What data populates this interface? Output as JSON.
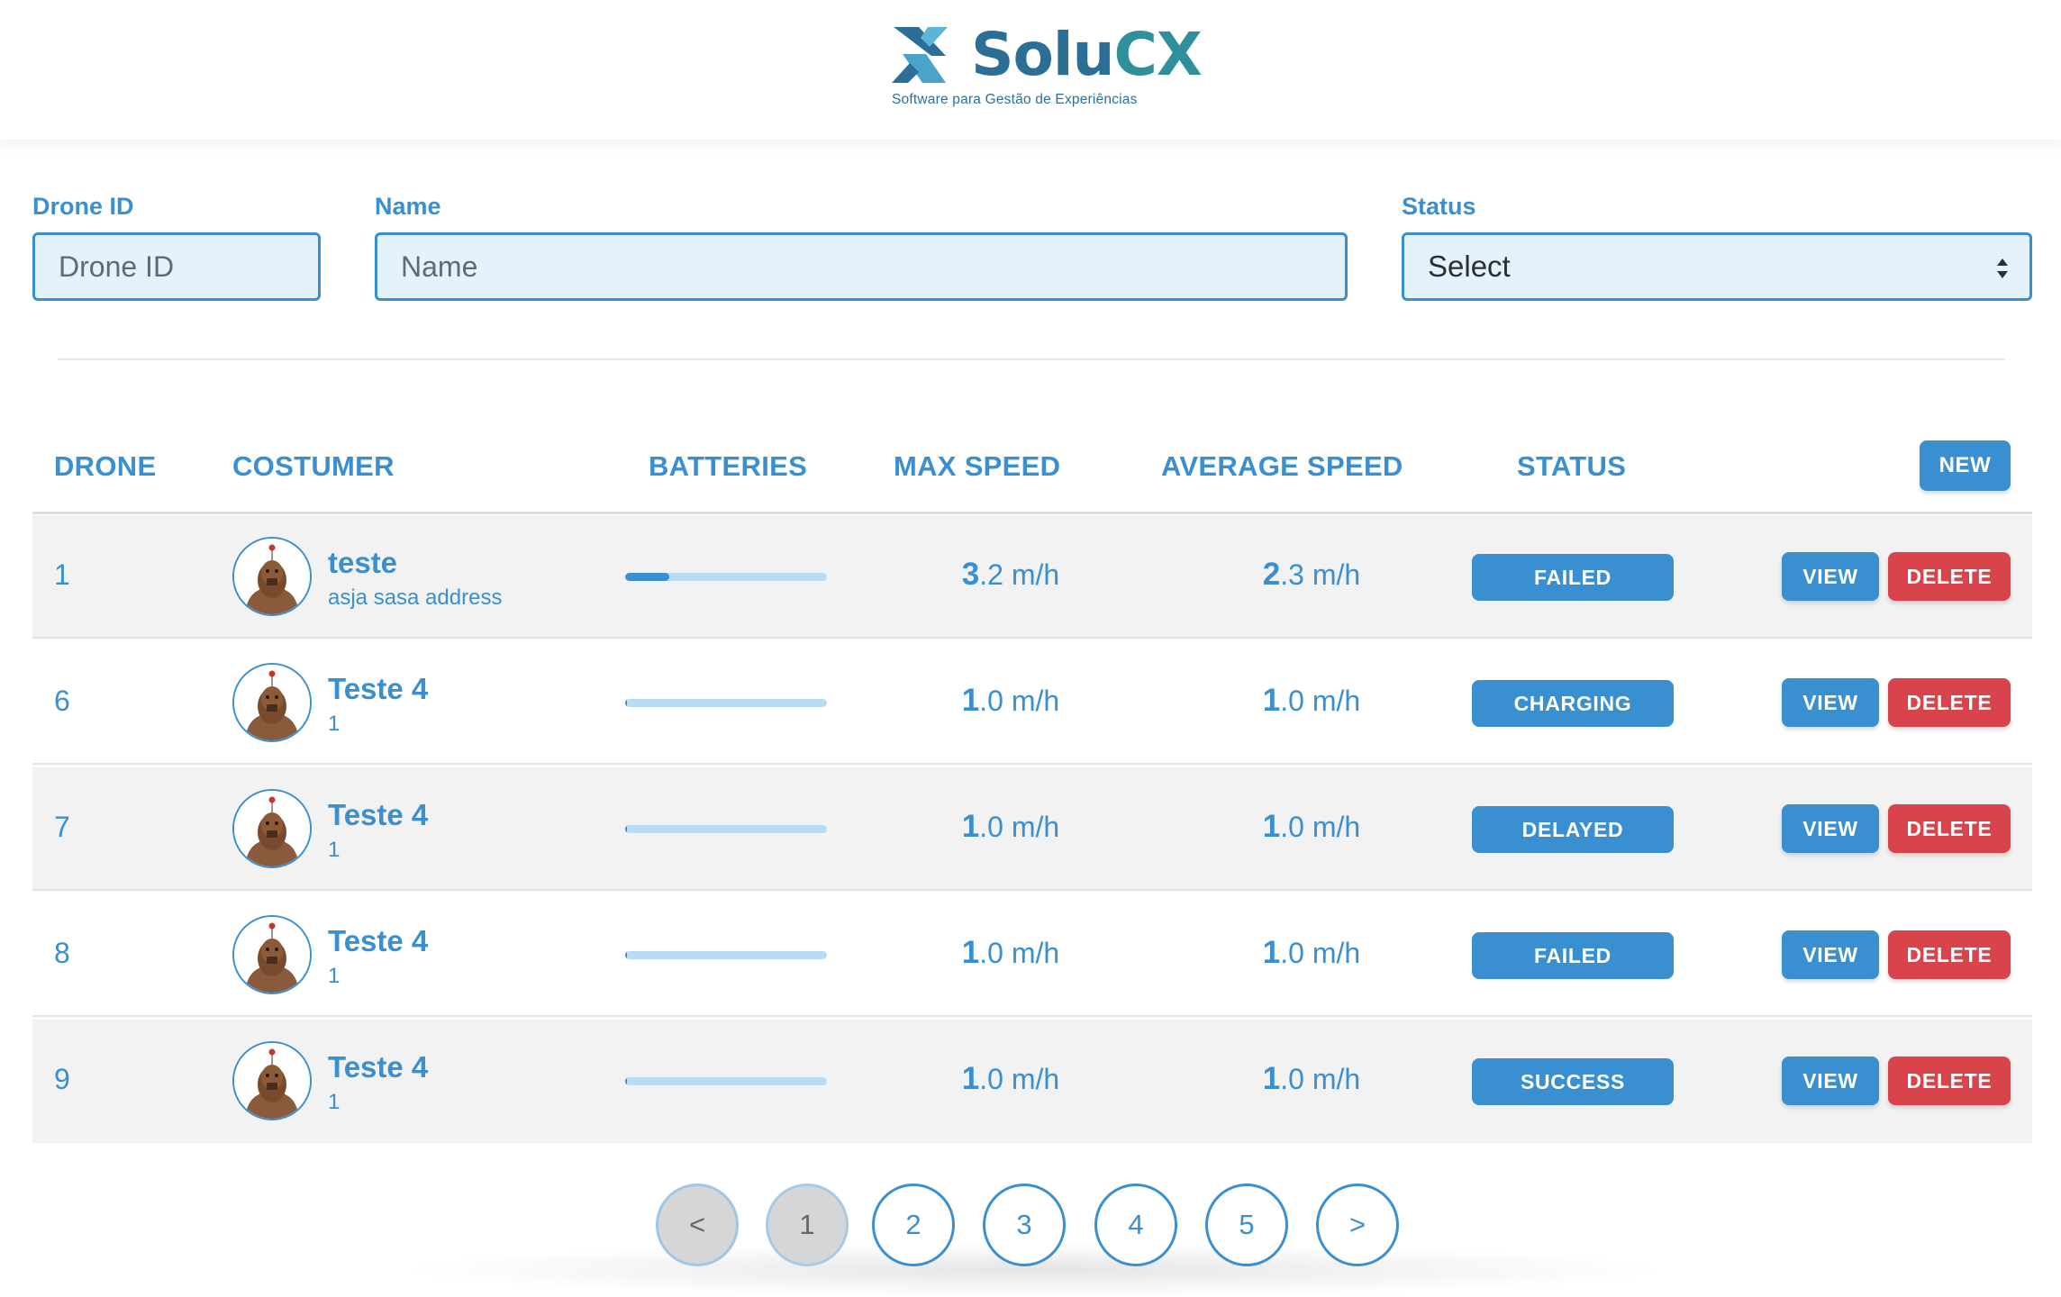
{
  "header": {
    "brand_solu": "Solu",
    "brand_cx": "CX",
    "tagline": "Software para Gestão de Experiências"
  },
  "filters": {
    "drone_id": {
      "label": "Drone ID",
      "placeholder": "Drone ID",
      "value": ""
    },
    "name": {
      "label": "Name",
      "placeholder": "Name",
      "value": ""
    },
    "status": {
      "label": "Status",
      "selected": "Select"
    }
  },
  "table": {
    "headers": {
      "drone": "DRONE",
      "customer": "COSTUMER",
      "batteries": "BATTERIES",
      "max_speed": "MAX SPEED",
      "average_speed": "AVERAGE SPEED",
      "status": "STATUS"
    },
    "new_button": "NEW",
    "rows": [
      {
        "id": "1",
        "name": "teste",
        "address": "asja sasa address",
        "battery": 0.22,
        "max_int": "3",
        "max_rest": ".2 m/h",
        "avg_int": "2",
        "avg_rest": ".3 m/h",
        "status": "FAILED",
        "view": "VIEW",
        "delete": "DELETE"
      },
      {
        "id": "6",
        "name": "Teste 4",
        "address": "1",
        "battery": 0.01,
        "max_int": "1",
        "max_rest": ".0 m/h",
        "avg_int": "1",
        "avg_rest": ".0 m/h",
        "status": "CHARGING",
        "view": "VIEW",
        "delete": "DELETE"
      },
      {
        "id": "7",
        "name": "Teste 4",
        "address": "1",
        "battery": 0.01,
        "max_int": "1",
        "max_rest": ".0 m/h",
        "avg_int": "1",
        "avg_rest": ".0 m/h",
        "status": "DELAYED",
        "view": "VIEW",
        "delete": "DELETE"
      },
      {
        "id": "8",
        "name": "Teste 4",
        "address": "1",
        "battery": 0.01,
        "max_int": "1",
        "max_rest": ".0 m/h",
        "avg_int": "1",
        "avg_rest": ".0 m/h",
        "status": "FAILED",
        "view": "VIEW",
        "delete": "DELETE"
      },
      {
        "id": "9",
        "name": "Teste 4",
        "address": "1",
        "battery": 0.01,
        "max_int": "1",
        "max_rest": ".0 m/h",
        "avg_int": "1",
        "avg_rest": ".0 m/h",
        "status": "SUCCESS",
        "view": "VIEW",
        "delete": "DELETE"
      }
    ]
  },
  "pagination": {
    "prev": "<",
    "next": ">",
    "pages": [
      "1",
      "2",
      "3",
      "4",
      "5"
    ],
    "current": "1"
  },
  "colors": {
    "primary": "#3a8fd0",
    "danger": "#d9434b",
    "brand_dark": "#2c6f96",
    "brand_teal": "#2f8f9b"
  }
}
